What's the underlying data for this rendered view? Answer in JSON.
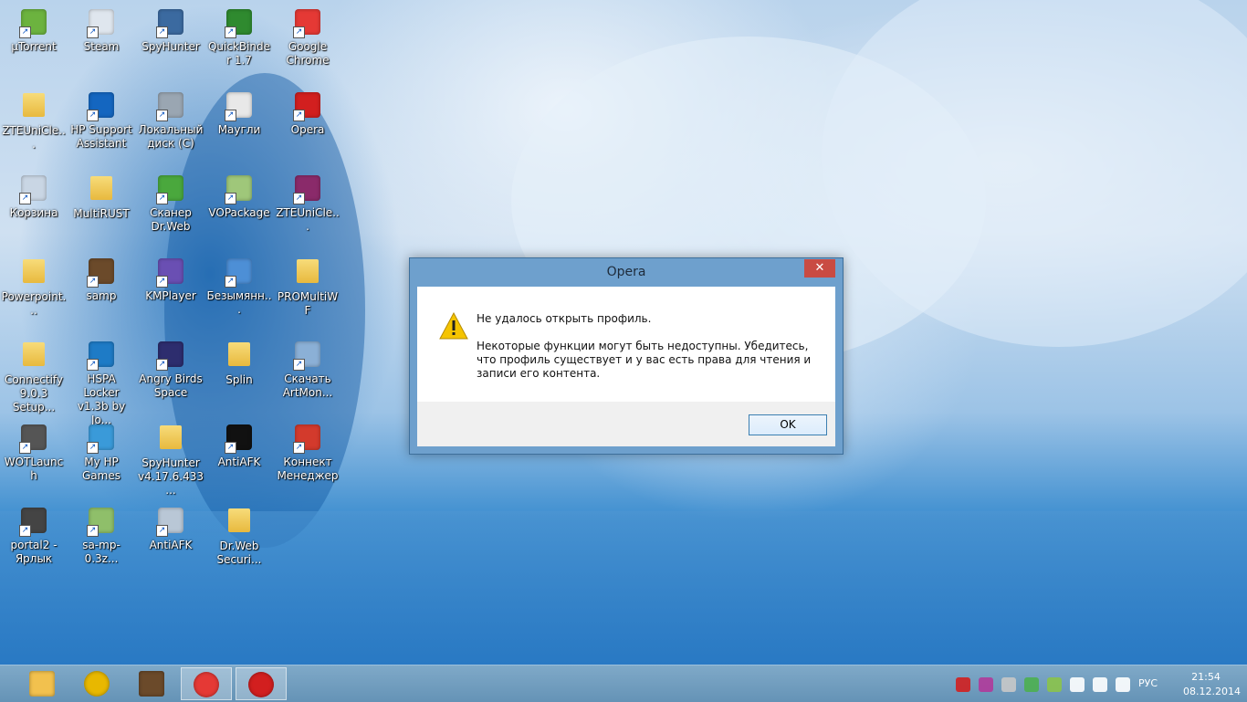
{
  "desktop": {
    "icons": [
      {
        "label": "µTorrent",
        "icon": "utorrent-icon",
        "color": "#6cb33f"
      },
      {
        "label": "Steam",
        "icon": "steam-icon",
        "color": "#dfe6ee"
      },
      {
        "label": "SpyHunter",
        "icon": "spyhunter-icon",
        "color": "#3b6aa0"
      },
      {
        "label": "QuickBinder 1.7",
        "icon": "quickbinder-icon",
        "color": "#2f8a2f"
      },
      {
        "label": "Google Chrome",
        "icon": "chrome-icon",
        "color": "#e53935"
      },
      {
        "label": "ZTEUniCle...",
        "icon": "folder-icon",
        "color": "#e8b93e"
      },
      {
        "label": "HP Support Assistant",
        "icon": "hp-support-icon",
        "color": "#1466c0"
      },
      {
        "label": "Локальный диск (C)",
        "icon": "drive-icon",
        "color": "#9aa6b2"
      },
      {
        "label": "Маугли",
        "icon": "mpeg-file-icon",
        "color": "#e8e8e8"
      },
      {
        "label": "Opera",
        "icon": "opera-icon",
        "color": "#d21f1f"
      },
      {
        "label": "Корзина",
        "icon": "recycle-bin-icon",
        "color": "#c9d6e4"
      },
      {
        "label": "MultiRUST",
        "icon": "folder-icon",
        "color": "#e8b93e"
      },
      {
        "label": "Сканер Dr.Web",
        "icon": "drweb-scanner-icon",
        "color": "#4aa83d"
      },
      {
        "label": "VOPackage",
        "icon": "vopackage-icon",
        "color": "#9fc77a"
      },
      {
        "label": "ZTEUniCle...",
        "icon": "winrar-icon",
        "color": "#8a2a6a"
      },
      {
        "label": "Powerpoint...",
        "icon": "folder-icon",
        "color": "#e8b93e"
      },
      {
        "label": "samp",
        "icon": "samp-icon",
        "color": "#6b4a2a"
      },
      {
        "label": "KMPlayer",
        "icon": "kmplayer-icon",
        "color": "#6a4fb3"
      },
      {
        "label": "Безымянн...",
        "icon": "scanner-icon",
        "color": "#4d8fd6"
      },
      {
        "label": "PROMultiWF",
        "icon": "folder-icon",
        "color": "#e8b93e"
      },
      {
        "label": "Connectify 9.0.3 Setup...",
        "icon": "folder-icon",
        "color": "#e8b93e"
      },
      {
        "label": "HSPA Locker v1.3b by Jo...",
        "icon": "hspa-locker-icon",
        "color": "#1e7bc6"
      },
      {
        "label": "Angry Birds Space",
        "icon": "angry-birds-icon",
        "color": "#2d2d6e"
      },
      {
        "label": "Splin",
        "icon": "folder-icon",
        "color": "#e8b93e"
      },
      {
        "label": "Скачать ArtMon...",
        "icon": "artmoney-icon",
        "color": "#8bb0d6"
      },
      {
        "label": "WOTLaunch",
        "icon": "wot-icon",
        "color": "#555555"
      },
      {
        "label": "My HP Games",
        "icon": "hp-games-icon",
        "color": "#3a9ad9"
      },
      {
        "label": "SpyHunter v4.17.6.433...",
        "icon": "folder-icon",
        "color": "#e8b93e"
      },
      {
        "label": "AntiAFK",
        "icon": "antiafk-r-icon",
        "color": "#111111"
      },
      {
        "label": "Коннект Менеджер",
        "icon": "connect-manager-icon",
        "color": "#d33a2c"
      },
      {
        "label": "portal2 - Ярлык",
        "icon": "portal2-icon",
        "color": "#444444"
      },
      {
        "label": "sa-mp-0.3z...",
        "icon": "samp-installer-icon",
        "color": "#8fbf6a"
      },
      {
        "label": "AntiAFK",
        "icon": "antiafk-gear-icon",
        "color": "#b9c7d6"
      },
      {
        "label": "Dr.Web Securi...",
        "icon": "folder-icon",
        "color": "#e8b93e"
      }
    ]
  },
  "dialog": {
    "title": "Opera",
    "close_symbol": "✕",
    "message_title": "Не удалось открыть профиль.",
    "message_body": "Некоторые функции могут быть недоступны. Убедитесь, что профиль существует и у вас есть права для чтения и записи его контента.",
    "ok_label": "OK"
  },
  "taskbar": {
    "buttons": [
      {
        "icon": "file-explorer-icon",
        "active": false
      },
      {
        "icon": "media-player-icon",
        "active": false
      },
      {
        "icon": "samp-icon",
        "active": false
      },
      {
        "icon": "chrome-icon",
        "active": true
      },
      {
        "icon": "opera-icon",
        "active": true
      }
    ],
    "tray": [
      "opera-tray-icon",
      "chat-tray-icon",
      "flag-tray-icon",
      "security-tray-icon",
      "drweb-tray-icon",
      "network-tray-icon",
      "signal-tray-icon",
      "volume-tray-icon"
    ],
    "language": "РУС",
    "time": "21:54",
    "date": "08.12.2014"
  },
  "colors": {
    "dialog_frame": "#6ea0cd",
    "close_button": "#c94b43",
    "taskbar": "#6f9bbd"
  }
}
